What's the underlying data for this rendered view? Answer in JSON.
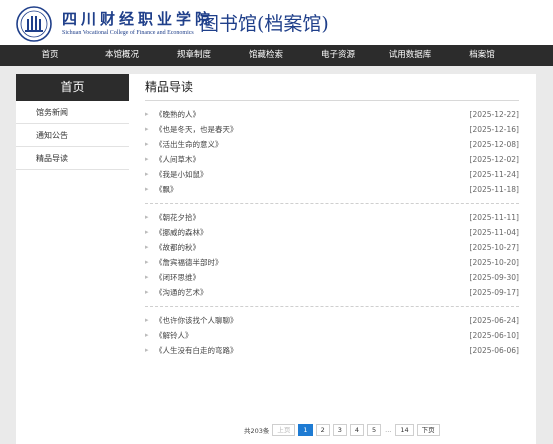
{
  "header": {
    "school_name_cn": "四川财经职业学院",
    "school_name_en": "Sichuan Vocational College of Finance and Economics",
    "library_title": "图书馆(档案馆)"
  },
  "nav": {
    "items": [
      "首页",
      "本馆概况",
      "规章制度",
      "馆藏检索",
      "电子资源",
      "试用数据库",
      "档案馆"
    ]
  },
  "sidebar": {
    "title": "首页",
    "items": [
      "馆务新闻",
      "通知公告",
      "精品导读"
    ]
  },
  "main": {
    "title": "精品导读",
    "groups": [
      {
        "rows": [
          {
            "title": "《晚熟的人》",
            "date": "[2025-12-22]"
          },
          {
            "title": "《也是冬天，也是春天》",
            "date": "[2025-12-16]"
          },
          {
            "title": "《活出生命的意义》",
            "date": "[2025-12-08]"
          },
          {
            "title": "《人间草木》",
            "date": "[2025-12-02]"
          },
          {
            "title": "《我是小如鼠》",
            "date": "[2025-11-24]"
          },
          {
            "title": "《飘》",
            "date": "[2025-11-18]"
          }
        ]
      },
      {
        "rows": [
          {
            "title": "《朝花夕拾》",
            "date": "[2025-11-11]"
          },
          {
            "title": "《挪威的森林》",
            "date": "[2025-11-04]"
          },
          {
            "title": "《故都的秋》",
            "date": "[2025-10-27]"
          },
          {
            "title": "《詹宾福德半部时》",
            "date": "[2025-10-20]"
          },
          {
            "title": "《闭环思维》",
            "date": "[2025-09-30]"
          },
          {
            "title": "《沟通的艺术》",
            "date": "[2025-09-17]"
          }
        ]
      },
      {
        "rows": [
          {
            "title": "《也许你该找个人聊聊》",
            "date": "[2025-06-24]"
          },
          {
            "title": "《解铃人》",
            "date": "[2025-06-10]"
          },
          {
            "title": "《人生没有白走的弯路》",
            "date": "[2025-06-06]"
          }
        ]
      }
    ]
  },
  "pagination": {
    "total_label": "共203条",
    "prev_label": "上页",
    "pages": [
      "1",
      "2",
      "3",
      "4",
      "5"
    ],
    "current_page": "1",
    "ellipsis": "...",
    "last_page": "14",
    "next_label": "下页"
  },
  "colors": {
    "nav_background": "#2c2c2c",
    "brand_blue": "#1f3f8a",
    "active_page": "#1e7bd3"
  }
}
